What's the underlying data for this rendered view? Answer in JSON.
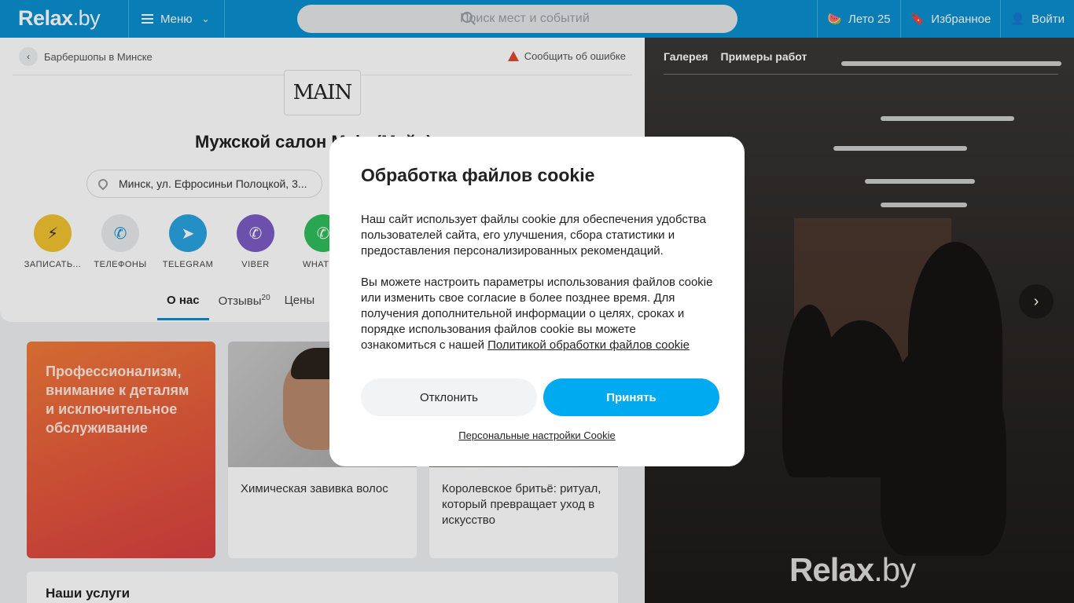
{
  "header": {
    "logo_main": "Relax",
    "logo_dot": ".by",
    "menu_label": "Меню",
    "search_placeholder": "Поиск мест и событий",
    "items": [
      {
        "icon": "watermelon-icon",
        "label": "Лето 25"
      },
      {
        "icon": "bookmark-icon",
        "label": "Избранное"
      },
      {
        "icon": "user-icon",
        "label": "Войти"
      }
    ]
  },
  "breadcrumb": {
    "label": "Барбершопы в Минске"
  },
  "report_label": "Сообщить об ошибке",
  "brand_logo_text": "MAIN",
  "salon": {
    "title": "Мужской салон Main (Мэйн)",
    "address": "Минск, ул. Ефросиньи Полоцкой, 3..."
  },
  "actions": [
    {
      "icon": "lightning-icon",
      "label": "ЗАПИСАТЬ...",
      "color": "#f2c230"
    },
    {
      "icon": "phone-icon",
      "label": "ТЕЛЕФОНЫ",
      "color": "#e8eaec"
    },
    {
      "icon": "telegram-icon",
      "label": "TELEGRAM",
      "color": "#2aa3e0"
    },
    {
      "icon": "viber-icon",
      "label": "VIBER",
      "color": "#7d5bc4"
    },
    {
      "icon": "whatsapp-icon",
      "label": "WHATS...",
      "color": "#2fbd5a"
    }
  ],
  "tabs": [
    {
      "label": "О нас",
      "active": true
    },
    {
      "label": "Отзывы",
      "count": "20"
    },
    {
      "label": "Цены"
    }
  ],
  "promo_text": "Профессионализм, внимание к деталям и исключительное обслуживание",
  "articles": [
    {
      "title": "Химическая завивка волос"
    },
    {
      "title": "Королевское бритьё: ритуал, который превращает уход в искусство"
    }
  ],
  "services_title": "Наши услуги",
  "gallery": {
    "tabs": [
      "Галерея",
      "Примеры работ"
    ],
    "watermark_main": "Relax",
    "watermark_dot": ".by"
  },
  "cookie_modal": {
    "title": "Обработка файлов cookie",
    "paragraph1": "Наш сайт использует файлы cookie для обеспечения удобства пользователей сайта, его улучшения, сбора статистики и предоставления персонализированных рекомендаций.",
    "paragraph2_text": "Вы можете настроить параметры использования файлов cookie или изменить свое согласие в более позднее время. Для получения дополнительной информации о целях, сроках и порядке использования файлов cookie вы можете ознакомиться с нашей ",
    "policy_link": "Политикой обработки файлов cookie",
    "decline_label": "Отклонить",
    "accept_label": "Принять",
    "settings_link": "Персональные настройки Cookie"
  },
  "colors": {
    "brand": "#0b8fd0",
    "accept_button": "#00aaf0"
  }
}
